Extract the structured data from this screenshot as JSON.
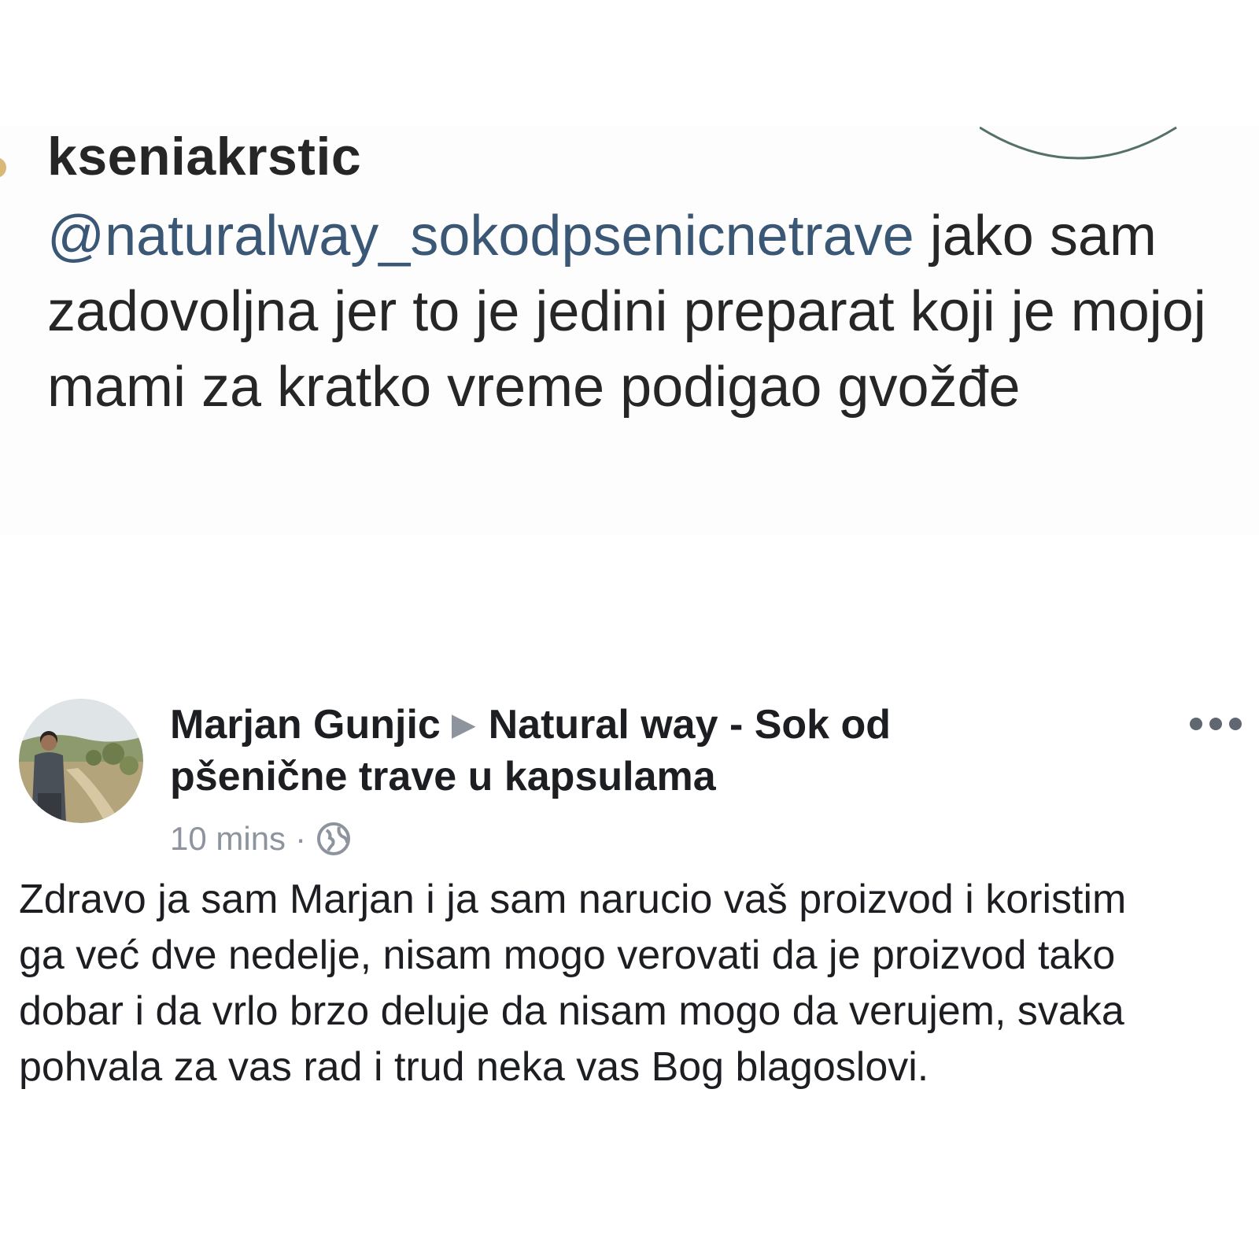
{
  "instagram_comment": {
    "username": "kseniakrstic",
    "mention": "@naturalway_sokodpsenicnetrave",
    "text": " jako sam zadovoljna jer to je jedini preparat koji je mojoj mami za kratko vreme podigao gvožđe"
  },
  "facebook_post": {
    "author": "Marjan Gunjic",
    "target_page": "Natural way - Sok od pšenične trave u kapsulama",
    "timestamp": "10 mins",
    "separator": "·",
    "privacy_icon": "globe-icon",
    "more_icon": "more-options-icon",
    "body_lines": [
      "Zdravo ja sam Marjan i ja sam narucio vaš proizvod i koristim",
      "ga već dve nedelje, nisam mogo verovati da je proizvod tako",
      "dobar i da vrlo brzo deluje da nisam mogo da verujem, svaka",
      "pohvala za vas rad i trud  neka vas Bog blagoslovi."
    ]
  },
  "colors": {
    "mention_link": "#3a5775",
    "text_primary": "#262626",
    "fb_text": "#1c1e21",
    "fb_secondary": "#8d949e"
  }
}
